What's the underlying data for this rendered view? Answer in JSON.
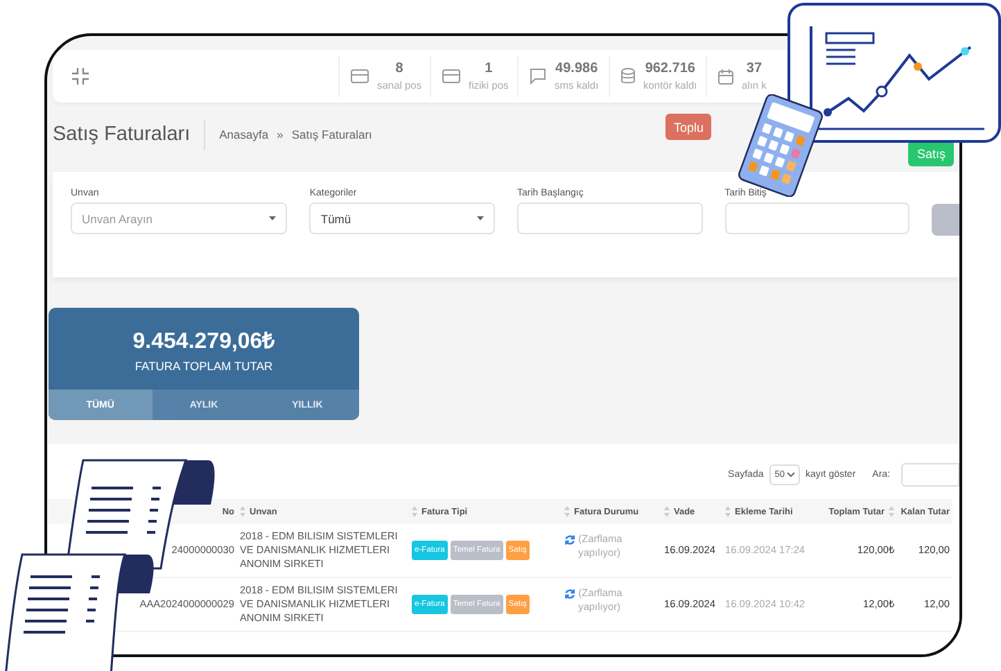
{
  "stats": [
    {
      "value": "8",
      "label": "sanal pos"
    },
    {
      "value": "1",
      "label": "fiziki pos"
    },
    {
      "value": "49.986",
      "label": "sms kaldı"
    },
    {
      "value": "962.716",
      "label": "kontör kaldı"
    },
    {
      "value": "37",
      "label": "alın k"
    }
  ],
  "page_title": "Satış Faturaları",
  "breadcrumb": [
    "Anasayfa",
    "Satış Faturaları"
  ],
  "breadcrumb_separator": "»",
  "actions": [
    {
      "label": "Toplu",
      "kind": "danger"
    },
    {
      "label": "Satış",
      "kind": "success"
    }
  ],
  "filters": [
    {
      "label": "Unvan",
      "kind": "select",
      "placeholder": "Unvan Arayın"
    },
    {
      "label": "Kategoriler",
      "kind": "select",
      "value": "Tümü"
    },
    {
      "label": "Tarih Başlangıç",
      "kind": "input"
    },
    {
      "label": "Tarih Bitiş",
      "kind": "input"
    }
  ],
  "summary": {
    "amount": "9.454.279,06₺",
    "label": "FATURA TOPLAM TUTAR",
    "tabs": [
      {
        "label": "TÜMÜ",
        "selected": true
      },
      {
        "label": "AYLIK",
        "selected": false
      },
      {
        "label": "YILLIK",
        "selected": false
      }
    ]
  },
  "table": {
    "page_size_label": "Sayfada",
    "page_size": "50",
    "page_size_suffix": "kayıt göster",
    "search_label": "Ara:",
    "columns": [
      "No",
      "Unvan",
      "Fatura Tipi",
      "Fatura Durumu",
      "Vade",
      "Ekleme Tarihi",
      "Toplam Tutar",
      "Kalan Tutar"
    ],
    "rows": [
      {
        "no": "24000000030",
        "unvan": "2018 - EDM BILISIM SISTEMLERI VE DANISMANLIK HIZMETLERI ANONIM SIRKETI",
        "tags": [
          {
            "label": "e-Fatura",
            "color": "#17c6e0"
          },
          {
            "label": "Temel Fatura",
            "color": "#b9bec8"
          },
          {
            "label": "Satış",
            "color": "#ff9f43"
          }
        ],
        "status": "(Zarflama yapılıyor)",
        "vade": "16.09.2024",
        "ekleme": "16.09.2024 17:24",
        "toplam": "120,00₺",
        "kalan": "120,00"
      },
      {
        "no": "AAA2024000000029",
        "unvan": "2018 - EDM BILISIM SISTEMLERI VE DANISMANLIK HIZMETLERI ANONIM SIRKETI",
        "tags": [
          {
            "label": "e-Fatura",
            "color": "#17c6e0"
          },
          {
            "label": "Temel Fatura",
            "color": "#b9bec8"
          },
          {
            "label": "Satış",
            "color": "#ff9f43"
          }
        ],
        "status": "(Zarflama yapılıyor)",
        "vade": "16.09.2024",
        "ekleme": "16.09.2024 10:42",
        "toplam": "12,00₺",
        "kalan": "12,00"
      }
    ]
  }
}
